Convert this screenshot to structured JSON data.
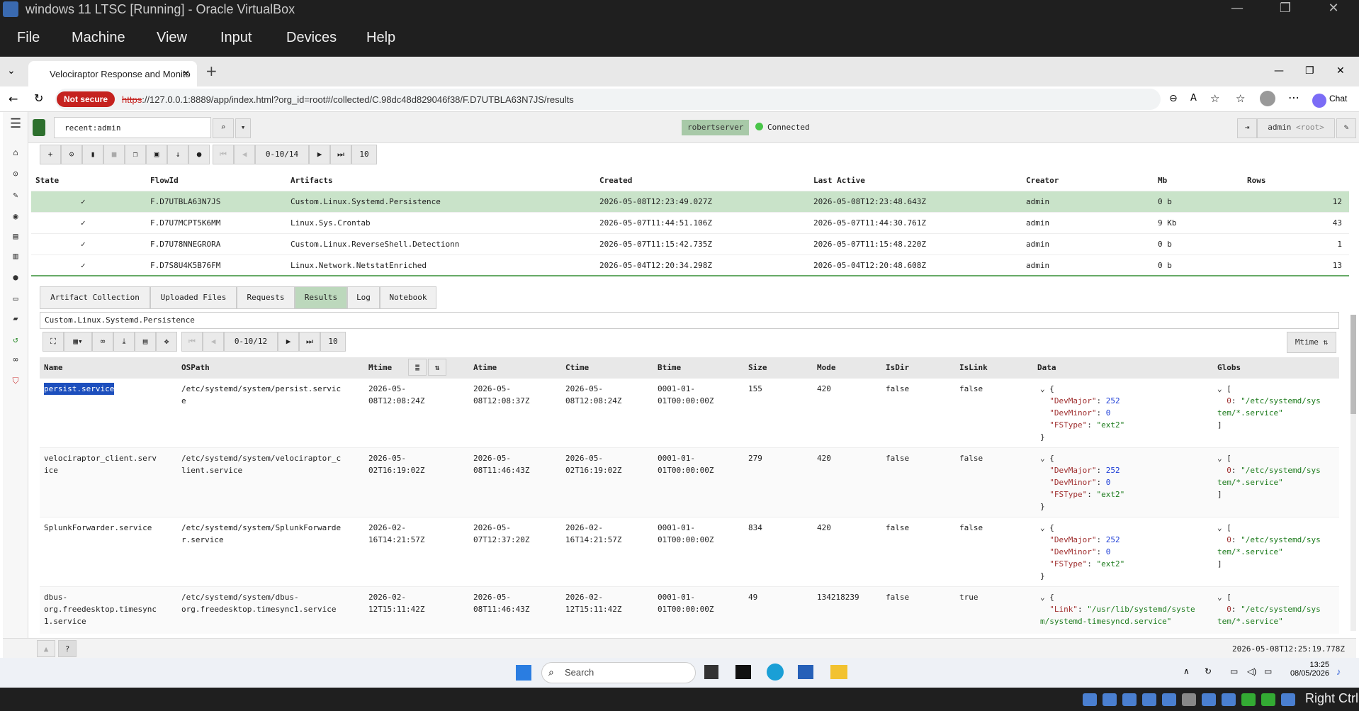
{
  "vbox": {
    "title": "windows 11 LTSC [Running] - Oracle VirtualBox",
    "menu": [
      "File",
      "Machine",
      "View",
      "Input",
      "Devices",
      "Help"
    ],
    "host_key": "Right Ctrl"
  },
  "browser": {
    "tab_title": "Velociraptor Response and Monito",
    "not_secure": "Not secure",
    "url_scheme": "https",
    "url_rest": "://127.0.0.1:8889/app/index.html?org_id=root#/collected/C.98dc48d829046f38/F.D7UTBLA63N7JS/results",
    "chat": "Chat"
  },
  "app": {
    "search_value": "recent:admin",
    "server": "robertserver",
    "connected": "Connected",
    "user": "admin",
    "user_org": "<root>",
    "pager1": "0-10/14",
    "pagesize1": "10",
    "pager2": "0-10/12",
    "pagesize2": "10",
    "sort_label": "Mtime",
    "artifact_name": "Custom.Linux.Systemd.Persistence",
    "timestamp": "2026-05-08T12:25:19.778Z"
  },
  "flows": {
    "headers": [
      "State",
      "FlowId",
      "Artifacts",
      "Created",
      "Last Active",
      "Creator",
      "Mb",
      "Rows"
    ],
    "rows": [
      {
        "state": "✓",
        "id": "F.D7UTBLA63N7JS",
        "artifact": "Custom.Linux.Systemd.Persistence",
        "created": "2026-05-08T12:23:49.027Z",
        "last": "2026-05-08T12:23:48.643Z",
        "creator": "admin",
        "mb": "0 b",
        "rows": "12"
      },
      {
        "state": "✓",
        "id": "F.D7U7MCPT5K6MM",
        "artifact": "Linux.Sys.Crontab",
        "created": "2026-05-07T11:44:51.106Z",
        "last": "2026-05-07T11:44:30.761Z",
        "creator": "admin",
        "mb": "9 Kb",
        "rows": "43"
      },
      {
        "state": "✓",
        "id": "F.D7U78NNEGRORA",
        "artifact": "Custom.Linux.ReverseShell.Detectionn",
        "created": "2026-05-07T11:15:42.735Z",
        "last": "2026-05-07T11:15:48.220Z",
        "creator": "admin",
        "mb": "0 b",
        "rows": "1"
      },
      {
        "state": "✓",
        "id": "F.D7S8U4K5B76FM",
        "artifact": "Linux.Network.NetstatEnriched",
        "created": "2026-05-04T12:20:34.298Z",
        "last": "2026-05-04T12:20:48.608Z",
        "creator": "admin",
        "mb": "0 b",
        "rows": "13"
      }
    ]
  },
  "tabs": [
    "Artifact Collection",
    "Uploaded Files",
    "Requests",
    "Results",
    "Log",
    "Notebook"
  ],
  "results": {
    "headers": [
      "Name",
      "OSPath",
      "Mtime",
      "Atime",
      "Ctime",
      "Btime",
      "Size",
      "Mode",
      "IsDir",
      "IsLink",
      "Data",
      "Globs"
    ],
    "rows": [
      {
        "name": "persist.service",
        "path": "/etc/systemd/system/persist.servic\ne",
        "mtime": "2026-05-\n08T12:08:24Z",
        "atime": "2026-05-\n08T12:08:37Z",
        "ctime": "2026-05-\n08T12:08:24Z",
        "btime": "0001-01-\n01T00:00:00Z",
        "size": "155",
        "mode": "420",
        "isdir": "false",
        "islink": "false",
        "major": "252",
        "minor": "0",
        "fstype": "\"ext2\"",
        "glob": "\"/etc/systemd/sys\ntem/*.service\""
      },
      {
        "name": "velociraptor_client.serv\nice",
        "path": "/etc/systemd/system/velociraptor_c\nlient.service",
        "mtime": "2026-05-\n02T16:19:02Z",
        "atime": "2026-05-\n08T11:46:43Z",
        "ctime": "2026-05-\n02T16:19:02Z",
        "btime": "0001-01-\n01T00:00:00Z",
        "size": "279",
        "mode": "420",
        "isdir": "false",
        "islink": "false",
        "major": "252",
        "minor": "0",
        "fstype": "\"ext2\"",
        "glob": "\"/etc/systemd/sys\ntem/*.service\""
      },
      {
        "name": "SplunkForwarder.service",
        "path": "/etc/systemd/system/SplunkForwarde\nr.service",
        "mtime": "2026-02-\n16T14:21:57Z",
        "atime": "2026-05-\n07T12:37:20Z",
        "ctime": "2026-02-\n16T14:21:57Z",
        "btime": "0001-01-\n01T00:00:00Z",
        "size": "834",
        "mode": "420",
        "isdir": "false",
        "islink": "false",
        "major": "252",
        "minor": "0",
        "fstype": "\"ext2\"",
        "glob": "\"/etc/systemd/sys\ntem/*.service\""
      },
      {
        "name": "dbus-\norg.freedesktop.timesync\n1.service",
        "path": "/etc/systemd/system/dbus-\norg.freedesktop.timesync1.service",
        "mtime": "2026-02-\n12T15:11:42Z",
        "atime": "2026-05-\n08T11:46:43Z",
        "ctime": "2026-02-\n12T15:11:42Z",
        "btime": "0001-01-\n01T00:00:00Z",
        "size": "49",
        "mode": "134218239",
        "isdir": "false",
        "islink": "true",
        "link": "\"/usr/lib/systemd/syste\nm/systemd-timesyncd.service\"",
        "glob": "\"/etc/systemd/sys\ntem/*.service\""
      }
    ]
  },
  "taskbar": {
    "search": "Search",
    "time": "13:25",
    "date": "08/05/2026"
  }
}
